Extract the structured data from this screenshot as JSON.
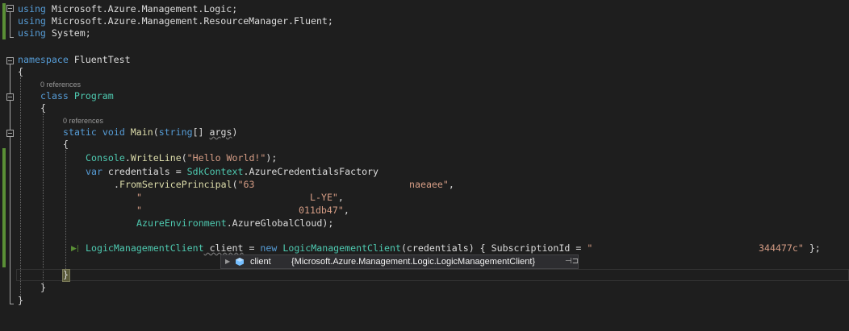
{
  "codelens": {
    "program_refs": "0 references",
    "main_refs": "0 references"
  },
  "code": {
    "l1_kw": "using",
    "l1_rest": " Microsoft.Azure.Management.Logic;",
    "l2_kw": "using",
    "l2_rest": " Microsoft.Azure.Management.ResourceManager.Fluent;",
    "l3_kw": "using",
    "l3_rest": " System;",
    "ns_kw": "namespace",
    "ns_name": " FluentTest",
    "open1": "{",
    "class_kw": "class",
    "class_name": "Program",
    "open2": "{",
    "main_static": "static",
    "main_void": "void",
    "main_name": "Main",
    "main_p1": "(",
    "main_string": "string",
    "main_p2": "[] ",
    "main_args": "args",
    "main_p3": ")",
    "open3": "{",
    "c1_type": "Console",
    "c1_dot": ".",
    "c1_fn": "WriteLine",
    "c1_p1": "(",
    "c1_str": "\"Hello World!\"",
    "c1_p2": ");",
    "c2_var": "var",
    "c2_name": " credentials",
    "c2_eq": " = ",
    "c2_type": "SdkContext",
    "c2_rest": ".AzureCredentialsFactory",
    "c3_pre": ".",
    "c3_fn": "FromServicePrincipal",
    "c3_p": "(",
    "c3_str1": "\"63",
    "c3_str2": "naeaee\"",
    "c3_comma": ",",
    "c4_str1": "\"",
    "c4_str2": "L-YE\"",
    "c4_comma": ",",
    "c5_str1": "\"",
    "c5_str2": "011db47\"",
    "c5_comma": ",",
    "c6_type": "AzureEnvironment",
    "c6_rest": ".AzureGlobalCloud);",
    "c7_type": "LogicManagementClient",
    "c7_name": " client",
    "c7_eq": " = ",
    "c7_new": "new",
    "c7_type2": " LogicManagementClient",
    "c7_args": "(credentials) { ",
    "c7_prop": "SubscriptionId",
    "c7_eq2": " = ",
    "c7_str1": "\"",
    "c7_str2": "344477c\"",
    "c7_end": " };",
    "close3": "}",
    "close2": "}",
    "close1": "}"
  },
  "datatip": {
    "name": "client",
    "value": "{Microsoft.Azure.Management.Logic.LogicManagementClient}",
    "expand_icon": "triangle-right-icon",
    "object_icon": "object-icon",
    "pin_icon": "pin-icon",
    "expand_glyph": "▶",
    "pin_glyph": "⊣⊐"
  },
  "colors": {
    "background": "#1e1e1e",
    "keyword": "#569cd6",
    "type": "#4ec9b0",
    "method": "#dcdcaa",
    "string": "#d69d85",
    "change_bar": "#5a8f36"
  }
}
